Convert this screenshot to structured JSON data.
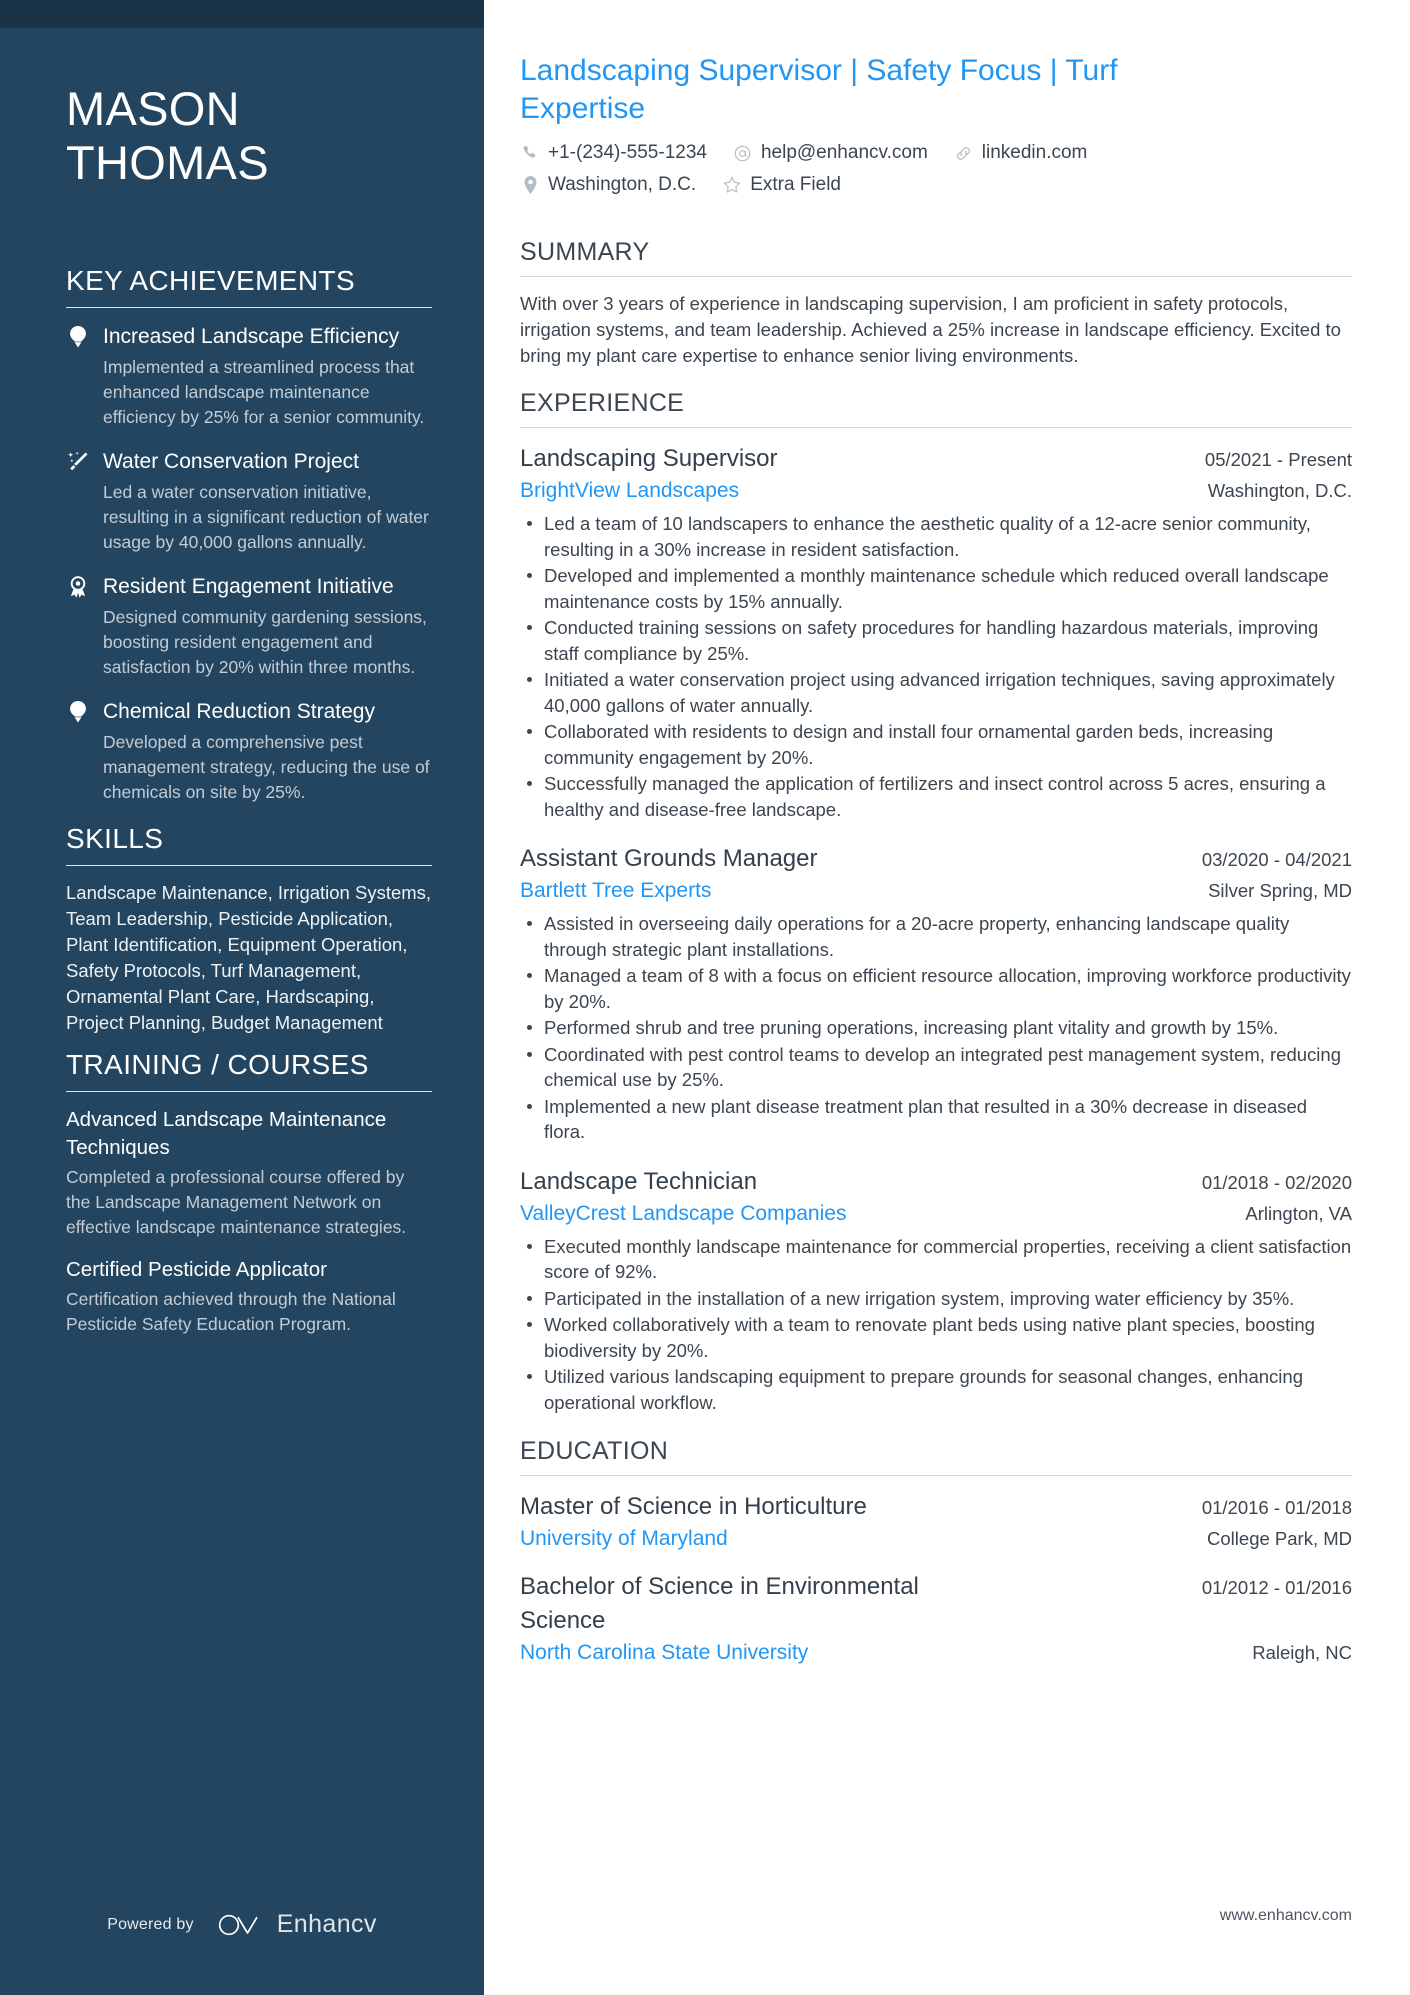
{
  "sidebar": {
    "name_first": "MASON",
    "name_last": "THOMAS",
    "achievements_heading": "KEY ACHIEVEMENTS",
    "achievements": [
      {
        "icon": "lightbulb-icon",
        "title": "Increased Landscape Efficiency",
        "description": "Implemented a streamlined process that enhanced landscape maintenance efficiency by 25% for a senior community."
      },
      {
        "icon": "magic-wand-icon",
        "title": "Water Conservation Project",
        "description": "Led a water conservation initiative, resulting in a significant reduction of water usage by 40,000 gallons annually."
      },
      {
        "icon": "award-ribbon-icon",
        "title": "Resident Engagement Initiative",
        "description": "Designed community gardening sessions, boosting resident engagement and satisfaction by 20% within three months."
      },
      {
        "icon": "lightbulb-icon",
        "title": "Chemical Reduction Strategy",
        "description": "Developed a comprehensive pest management strategy, reducing the use of chemicals on site by 25%."
      }
    ],
    "skills_heading": "SKILLS",
    "skills_text": "Landscape Maintenance, Irrigation Systems, Team Leadership, Pesticide Application, Plant Identification, Equipment Operation, Safety Protocols, Turf Management, Ornamental Plant Care, Hardscaping, Project Planning, Budget Management",
    "training_heading": "TRAINING / COURSES",
    "courses": [
      {
        "title": "Advanced Landscape Maintenance Techniques",
        "description": "Completed a professional course offered by the Landscape Management Network on effective landscape maintenance strategies."
      },
      {
        "title": "Certified Pesticide Applicator",
        "description": "Certification achieved through the National Pesticide Safety Education Program."
      }
    ],
    "footer": {
      "powered_by": "Powered by",
      "brand": "Enhancv"
    }
  },
  "main": {
    "headline": "Landscaping Supervisor | Safety Focus | Turf Expertise",
    "contacts_row1": [
      {
        "icon": "phone-icon",
        "text": "+1-(234)-555-1234"
      },
      {
        "icon": "at-sign-icon",
        "text": "help@enhancv.com"
      },
      {
        "icon": "link-icon",
        "text": "linkedin.com"
      }
    ],
    "contacts_row2": [
      {
        "icon": "map-pin-icon",
        "text": "Washington, D.C."
      },
      {
        "icon": "star-icon",
        "text": "Extra Field"
      }
    ],
    "summary_heading": "SUMMARY",
    "summary_text": "With over 3 years of experience in landscaping supervision, I am proficient in safety protocols, irrigation systems, and team leadership. Achieved a 25% increase in landscape efficiency. Excited to bring my plant care expertise to enhance senior living environments.",
    "experience_heading": "EXPERIENCE",
    "jobs": [
      {
        "title": "Landscaping Supervisor",
        "date": "05/2021 - Present",
        "company": "BrightView Landscapes",
        "location": "Washington, D.C.",
        "bullets": [
          "Led a team of 10 landscapers to enhance the aesthetic quality of a 12-acre senior community, resulting in a 30% increase in resident satisfaction.",
          "Developed and implemented a monthly maintenance schedule which reduced overall landscape maintenance costs by 15% annually.",
          "Conducted training sessions on safety procedures for handling hazardous materials, improving staff compliance by 25%.",
          "Initiated a water conservation project using advanced irrigation techniques, saving approximately 40,000 gallons of water annually.",
          "Collaborated with residents to design and install four ornamental garden beds, increasing community engagement by 20%.",
          "Successfully managed the application of fertilizers and insect control across 5 acres, ensuring a healthy and disease-free landscape."
        ]
      },
      {
        "title": "Assistant Grounds Manager",
        "date": "03/2020 - 04/2021",
        "company": "Bartlett Tree Experts",
        "location": "Silver Spring, MD",
        "bullets": [
          "Assisted in overseeing daily operations for a 20-acre property, enhancing landscape quality through strategic plant installations.",
          "Managed a team of 8 with a focus on efficient resource allocation, improving workforce productivity by 20%.",
          "Performed shrub and tree pruning operations, increasing plant vitality and growth by 15%.",
          "Coordinated with pest control teams to develop an integrated pest management system, reducing chemical use by 25%.",
          "Implemented a new plant disease treatment plan that resulted in a 30% decrease in diseased flora."
        ]
      },
      {
        "title": "Landscape Technician",
        "date": "01/2018 - 02/2020",
        "company": "ValleyCrest Landscape Companies",
        "location": "Arlington, VA",
        "bullets": [
          "Executed monthly landscape maintenance for commercial properties, receiving a client satisfaction score of 92%.",
          "Participated in the installation of a new irrigation system, improving water efficiency by 35%.",
          "Worked collaboratively with a team to renovate plant beds using native plant species, boosting biodiversity by 20%.",
          "Utilized various landscaping equipment to prepare grounds for seasonal changes, enhancing operational workflow."
        ]
      }
    ],
    "education_heading": "EDUCATION",
    "education": [
      {
        "degree": "Master of Science in Horticulture",
        "date": "01/2016 - 01/2018",
        "school": "University of Maryland",
        "location": "College Park, MD"
      },
      {
        "degree": "Bachelor of Science in Environmental Science",
        "date": "01/2012 - 01/2016",
        "school": "North Carolina State University",
        "location": "Raleigh, NC"
      }
    ],
    "footer_url": "www.enhancv.com"
  },
  "colors": {
    "sidebar_bg": "#23455f",
    "sidebar_topbar": "#1b3347",
    "accent_blue": "#2196f3",
    "body_text": "#3c4650"
  }
}
